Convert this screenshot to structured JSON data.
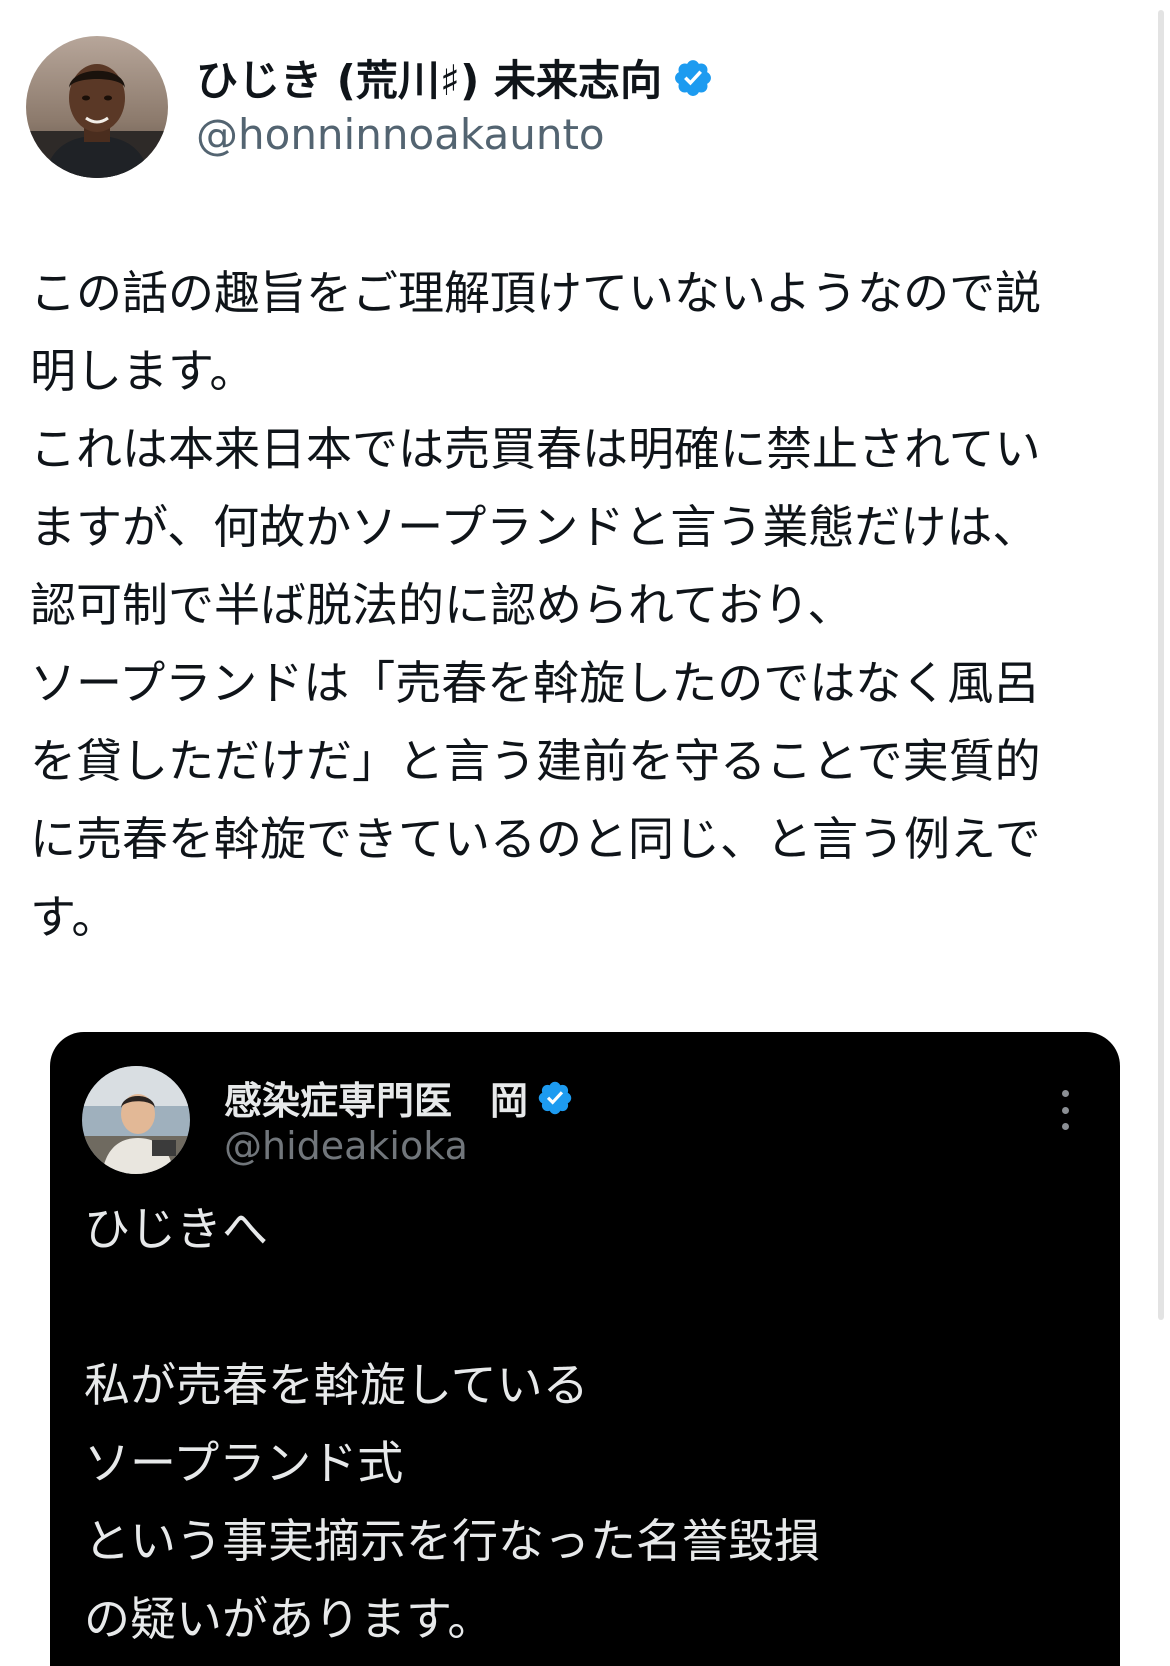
{
  "tweet": {
    "author": {
      "display_name": "ひじき (荒川♯) 未来志向",
      "handle": "@honninnoakaunto"
    },
    "text_lines": [
      "この話の趣旨をご理解頂けていないようなので説",
      "明します。",
      "これは本来日本では売買春は明確に禁止されてい",
      "ますが、何故かソープランドと言う業態だけは、",
      "認可制で半ば脱法的に認められており、",
      "ソープランドは「売春を斡旋したのではなく風呂",
      "を貸しただけだ」と言う建前を守ることで実質的",
      "に売春を斡旋できているのと同じ、と言う例えで",
      "す。"
    ]
  },
  "quoted_tweet": {
    "author": {
      "display_name": "感染症専門医　岡",
      "handle": "@hideakioka"
    },
    "text_lines": [
      "ひじきへ",
      "",
      "私が売春を斡旋している",
      "ソープランド式",
      "という事実摘示を行なった名誉毀損",
      "の疑いがあります。"
    ]
  },
  "icons": {
    "verified": "verified-badge-icon",
    "more": "more-options-icon"
  },
  "colors": {
    "verified_blue": "#1d9bf0",
    "handle_gray": "#536471",
    "dark_card": "#000000"
  }
}
